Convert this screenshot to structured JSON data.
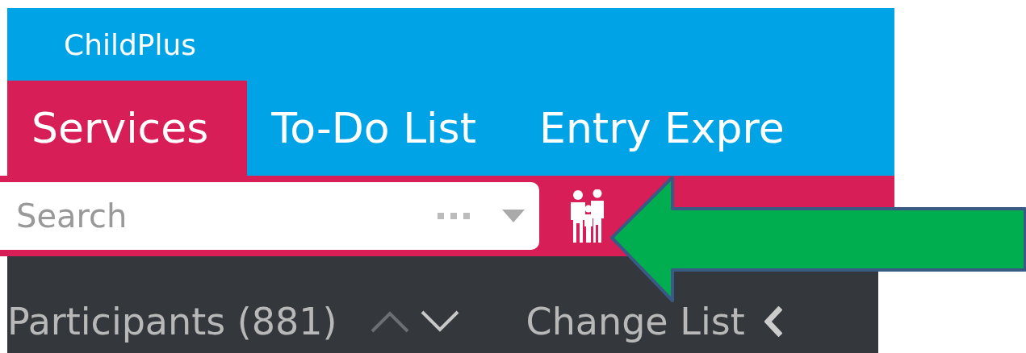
{
  "app": {
    "title": "ChildPlus"
  },
  "tabs": [
    {
      "label": "Services",
      "selected": true
    },
    {
      "label": "To-Do List",
      "selected": false
    },
    {
      "label": "Entry Expre",
      "selected": false
    }
  ],
  "search": {
    "placeholder": "Search"
  },
  "list_bar": {
    "title": "Participants (881)",
    "previous_disabled": true,
    "next_disabled": false,
    "change_list": "Change List"
  }
}
